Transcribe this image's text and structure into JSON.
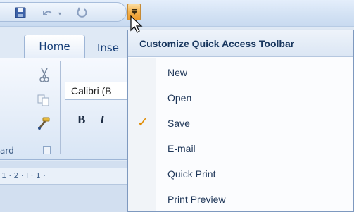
{
  "tabs": [
    "Home",
    "Inse"
  ],
  "font_name": "Calibri (B",
  "format_buttons": {
    "bold": "B",
    "italic": "I"
  },
  "clipboard_label": "ard",
  "ruler_text": "1 · 2 · I · 1 ·",
  "menu": {
    "title": "Customize Quick Access Toolbar",
    "items": [
      {
        "label": "New",
        "checked": false
      },
      {
        "label": "Open",
        "checked": false
      },
      {
        "label": "Save",
        "checked": true
      },
      {
        "label": "E-mail",
        "checked": false
      },
      {
        "label": "Quick Print",
        "checked": false
      },
      {
        "label": "Print Preview",
        "checked": false
      }
    ],
    "check_glyph": "✓"
  },
  "colors": {
    "accent_orange": "#f3b24f",
    "menu_text": "#1d3557",
    "ribbon_blue": "#dfe9f5"
  },
  "icons": [
    "save-icon",
    "undo-icon",
    "redo-icon",
    "dropdown-arrow-icon",
    "scissors-icon",
    "copy-icon",
    "format-painter-icon",
    "dialog-launcher-icon",
    "checkmark-icon",
    "mouse-pointer-icon"
  ]
}
